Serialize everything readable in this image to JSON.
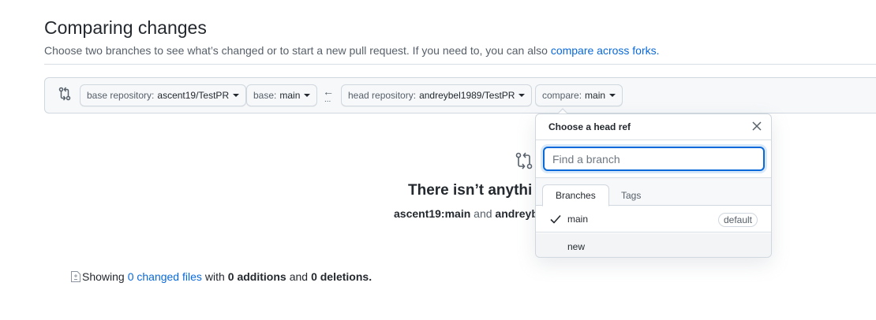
{
  "header": {
    "title": "Comparing changes",
    "subtitle": "Choose two branches to see what’s changed or to start a new pull request. If you need to, you can also",
    "subtitle_link": "compare across forks."
  },
  "range": {
    "base_repo_label": "base repository:",
    "base_repo_value": "ascent19/TestPR",
    "base_label": "base:",
    "base_value": "main",
    "arrow": "←",
    "dots": "...",
    "head_repo_label": "head repository:",
    "head_repo_value": "andreybel1989/TestPR",
    "compare_label": "compare:",
    "compare_value": "main"
  },
  "blankslate": {
    "title": "There isn’t anythi",
    "sub_base": "ascent19:main",
    "sub_and": "and",
    "sub_head": "andreybe"
  },
  "summary": {
    "showing": "Showing",
    "changed_files": "0 changed files",
    "with": "with",
    "additions": "0 additions",
    "and": "and",
    "deletions": "0 deletions."
  },
  "dropdown": {
    "header": "Choose a head ref",
    "filter_placeholder": "Find a branch",
    "tabs": [
      "Branches",
      "Tags"
    ],
    "items": [
      {
        "label": "main",
        "badge": "default",
        "selected": true
      },
      {
        "label": "new",
        "badge": "",
        "selected": false
      }
    ]
  },
  "colors": {
    "link": "#0969da",
    "border": "#d0d7de",
    "muted": "#57606a"
  }
}
